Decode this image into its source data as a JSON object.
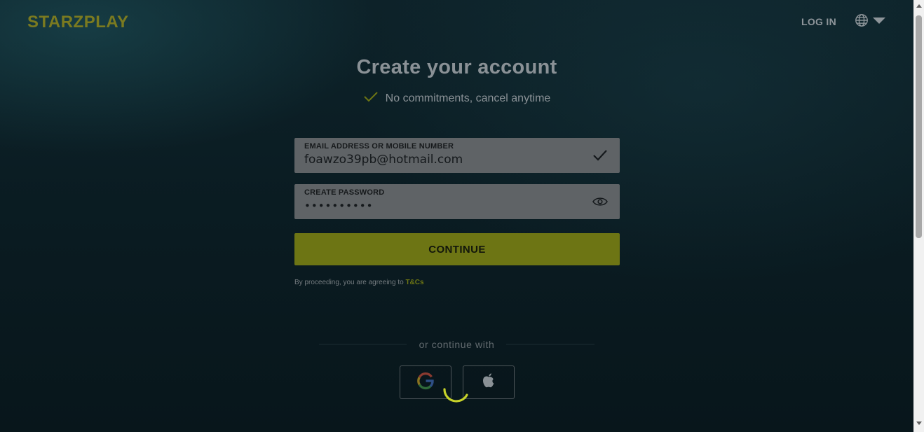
{
  "header": {
    "logo_text": "STARZPLAY",
    "login_label": "LOG IN",
    "language_icon": "globe-icon",
    "language_dropdown_icon": "caret-down-icon"
  },
  "main": {
    "title": "Create your account",
    "subtitle": "No commitments, cancel anytime",
    "subtitle_icon": "checkmark-icon"
  },
  "form": {
    "email": {
      "label": "EMAIL ADDRESS OR MOBILE NUMBER",
      "value": "foawzo39pb@hotmail.com",
      "status_icon": "checkmark-icon"
    },
    "password": {
      "label": "CREATE PASSWORD",
      "value": "••••••••••",
      "toggle_icon": "eye-icon"
    },
    "continue_label": "CONTINUE",
    "terms_text": "By proceeding, you are agreeing to",
    "terms_link": "T&Cs"
  },
  "social": {
    "divider_text": "or continue with",
    "providers": [
      {
        "name": "Google",
        "icon": "google-icon"
      },
      {
        "name": "Apple",
        "icon": "apple-icon"
      }
    ]
  },
  "colors": {
    "accent": "#c6d22a",
    "overlay_accent": "#6d7514",
    "background": "#0a1b21"
  }
}
